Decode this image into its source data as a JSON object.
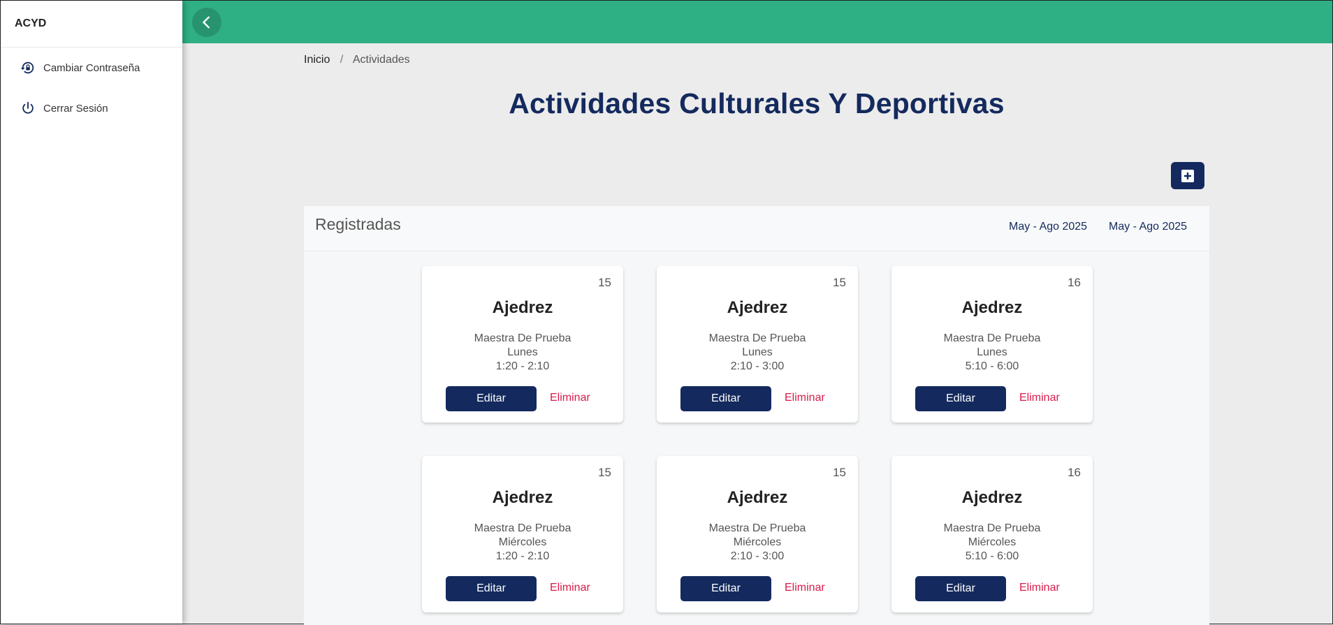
{
  "sidebar": {
    "brand": "ACYD",
    "items": [
      {
        "label": "Cambiar Contraseña",
        "icon": "lock-reset-icon"
      },
      {
        "label": "Cerrar Sesión",
        "icon": "power-icon"
      }
    ]
  },
  "topbar": {
    "back_icon": "chevron-left-icon",
    "color": "#2faf84"
  },
  "breadcrumb": {
    "home": "Inicio",
    "separator": "/",
    "current": "Actividades"
  },
  "page_title": "Actividades Culturales Y Deportivas",
  "add_button": {
    "icon": "plus-box-icon"
  },
  "panel": {
    "title": "Registradas",
    "terms": [
      "May - Ago 2025",
      "May - Ago 2025"
    ]
  },
  "cards": [
    {
      "count": "15",
      "name": "Ajedrez",
      "teacher": "Maestra De Prueba",
      "day": "Lunes",
      "time": "1:20 - 2:10",
      "edit": "Editar",
      "delete": "Eliminar"
    },
    {
      "count": "15",
      "name": "Ajedrez",
      "teacher": "Maestra De Prueba",
      "day": "Lunes",
      "time": "2:10 - 3:00",
      "edit": "Editar",
      "delete": "Eliminar"
    },
    {
      "count": "16",
      "name": "Ajedrez",
      "teacher": "Maestra De Prueba",
      "day": "Lunes",
      "time": "5:10 - 6:00",
      "edit": "Editar",
      "delete": "Eliminar"
    },
    {
      "count": "15",
      "name": "Ajedrez",
      "teacher": "Maestra De Prueba",
      "day": "Miércoles",
      "time": "1:20 - 2:10",
      "edit": "Editar",
      "delete": "Eliminar"
    },
    {
      "count": "15",
      "name": "Ajedrez",
      "teacher": "Maestra De Prueba",
      "day": "Miércoles",
      "time": "2:10 - 3:00",
      "edit": "Editar",
      "delete": "Eliminar"
    },
    {
      "count": "16",
      "name": "Ajedrez",
      "teacher": "Maestra De Prueba",
      "day": "Miércoles",
      "time": "5:10 - 6:00",
      "edit": "Editar",
      "delete": "Eliminar"
    }
  ],
  "colors": {
    "primary": "#142a5e",
    "danger": "#d81b4a",
    "header": "#2faf84"
  }
}
